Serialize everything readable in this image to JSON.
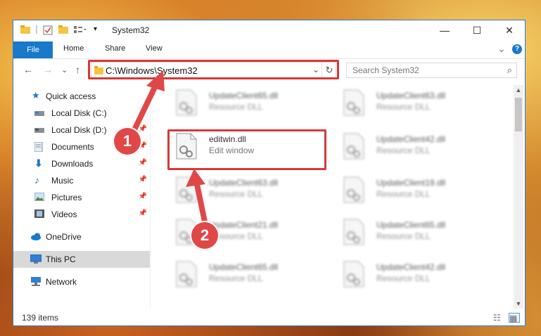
{
  "window": {
    "title": "System32",
    "controls": {
      "minimize": "—",
      "maximize": "☐",
      "close": "✕"
    }
  },
  "ribbon": {
    "tabs": [
      "File",
      "Home",
      "Share",
      "View"
    ],
    "expand": "⌄",
    "help": "?"
  },
  "nav": {
    "back": "←",
    "forward": "→",
    "recent": "⌄",
    "up": "↑",
    "address": "C:\\Windows\\System32",
    "address_dropdown": "⌄",
    "refresh": "↻",
    "search_placeholder": "Search System32",
    "search_icon": "⌕"
  },
  "sidebar": {
    "items": [
      {
        "label": "Quick access",
        "icon": "star-icon",
        "pinned": false
      },
      {
        "label": "Local Disk (C:)",
        "icon": "drive-icon",
        "pinned": false
      },
      {
        "label": "Local Disk (D:)",
        "icon": "drive-icon",
        "pinned": true
      },
      {
        "label": "Documents",
        "icon": "documents-icon",
        "pinned": true
      },
      {
        "label": "Downloads",
        "icon": "download-icon",
        "pinned": true
      },
      {
        "label": "Music",
        "icon": "music-icon",
        "pinned": true
      },
      {
        "label": "Pictures",
        "icon": "pictures-icon",
        "pinned": true
      },
      {
        "label": "Videos",
        "icon": "videos-icon",
        "pinned": true
      },
      {
        "label": "OneDrive",
        "icon": "cloud-icon",
        "pinned": false
      },
      {
        "label": "This PC",
        "icon": "computer-icon",
        "pinned": false,
        "selected": true
      },
      {
        "label": "Network",
        "icon": "network-icon",
        "pinned": false
      }
    ],
    "pin_glyph": "📌"
  },
  "files": {
    "left_column": [
      {
        "name": "UpdateClient65.dll",
        "type": "Resource DLL"
      },
      {
        "name": "editwin.dll",
        "type": "Edit window"
      },
      {
        "name": "UpdateClient63.dll",
        "type": "Resource DLL"
      },
      {
        "name": "UpdateClient21.dll",
        "type": "Resource DLL"
      },
      {
        "name": "UpdateClient65.dll",
        "type": "Resource DLL"
      }
    ],
    "right_column": [
      {
        "name": "UpdateClient63.dll",
        "type": "Resource DLL"
      },
      {
        "name": "UpdateClient42.dll",
        "type": "Resource DLL"
      },
      {
        "name": "UpdateClient19.dll",
        "type": "Resource DLL"
      },
      {
        "name": "UpdateClient65.dll",
        "type": "Resource DLL"
      },
      {
        "name": "UpdateClient42.dll",
        "type": "Resource DLL"
      }
    ]
  },
  "status": {
    "items": "139 items"
  },
  "annotations": {
    "step1": "1",
    "step2": "2"
  },
  "colors": {
    "accent": "#1979ca",
    "highlight": "#d43a3a",
    "badge": "#e04848"
  }
}
